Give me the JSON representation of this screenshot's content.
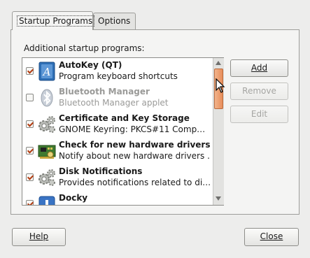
{
  "tabs": [
    {
      "label": "Startup Programs",
      "active": true
    },
    {
      "label": "Options",
      "active": false
    }
  ],
  "list": {
    "label": "Additional startup programs:",
    "items": [
      {
        "name": "AutoKey (QT)",
        "description": "Program keyboard shortcuts",
        "checked": true,
        "enabled": true,
        "icon": "autokey-icon"
      },
      {
        "name": "Bluetooth Manager",
        "description": "Bluetooth Manager applet",
        "checked": false,
        "enabled": false,
        "icon": "bluetooth-icon"
      },
      {
        "name": "Certificate and Key Storage",
        "description": "GNOME Keyring: PKCS#11 Comp…",
        "checked": true,
        "enabled": true,
        "icon": "gears-icon"
      },
      {
        "name": "Check for new hardware drivers",
        "description": "Notify about new hardware drivers …",
        "checked": true,
        "enabled": true,
        "icon": "hardware-driver-icon"
      },
      {
        "name": "Disk Notifications",
        "description": "Provides notifications related to di…",
        "checked": true,
        "enabled": true,
        "icon": "gears-icon"
      },
      {
        "name": "Docky",
        "description": "",
        "checked": true,
        "enabled": true,
        "icon": "docky-icon"
      }
    ]
  },
  "buttons": {
    "add": "Add",
    "remove": "Remove",
    "edit": "Edit",
    "help": "Help",
    "close": "Close"
  },
  "colors": {
    "checkmark": "#b23b10",
    "scroll_thumb": "#e78d5a"
  }
}
